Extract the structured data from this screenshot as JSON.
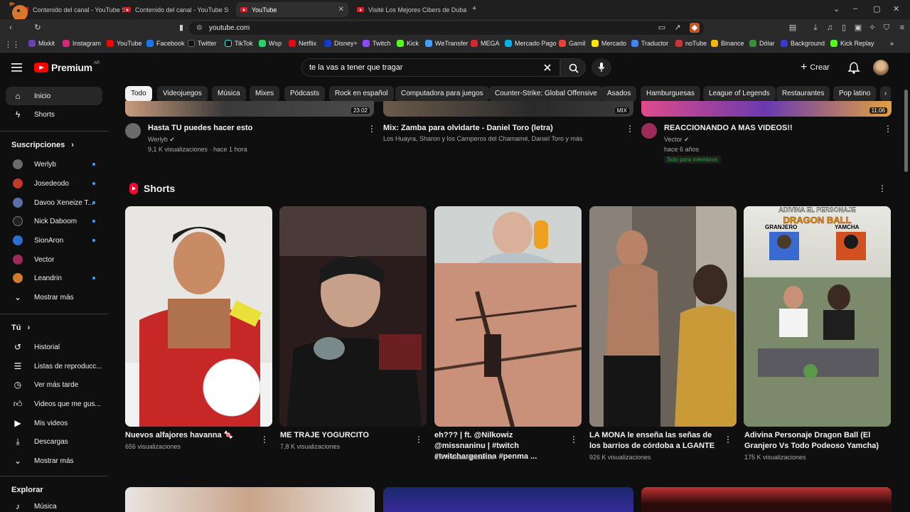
{
  "browser": {
    "tabs": [
      {
        "label": "Contenido del canal - YouTube Studi",
        "active": false
      },
      {
        "label": "Contenido del canal - YouTube Studi",
        "active": false
      },
      {
        "label": "YouTube",
        "active": true
      },
      {
        "label": "Visité Los Mejores Cibers de Dubai -",
        "active": false
      }
    ],
    "url": "youtube.com",
    "bookmarks": [
      "Mixkit",
      "Instagram",
      "YouTube",
      "Facebook",
      "Twitter",
      "TikTok",
      "Wsp",
      "Netflix",
      "Disney+",
      "Twitch",
      "Kick",
      "WeTransfer",
      "MEGA",
      "Mercado Pago",
      "Gamil",
      "Mercado",
      "Traductor",
      "noTube",
      "Binance",
      "Dólar",
      "Background",
      "Kick Replay"
    ]
  },
  "masthead": {
    "logo": "Premium",
    "region": "AR",
    "search_value": "te la vas a tener que tragar",
    "create_label": "Crear"
  },
  "chips": [
    "Todo",
    "Videojuegos",
    "Música",
    "Mixes",
    "Pódcasts",
    "Rock en español",
    "Computadora para juegos",
    "Counter-Strike: Global Offensive",
    "Asados",
    "Hamburguesas",
    "League of Legends",
    "Restaurantes",
    "Pop latino"
  ],
  "sidebar": {
    "main": [
      {
        "label": "Inicio",
        "icon": "home-icon"
      },
      {
        "label": "Shorts",
        "icon": "shorts-icon"
      }
    ],
    "subscriptions_title": "Suscripciones",
    "subscriptions": [
      {
        "label": "Werlyb",
        "color": "#6b6b6b"
      },
      {
        "label": "Josedeodo",
        "color": "#c0392b"
      },
      {
        "label": "Davoo Xeneize T...",
        "color": "#5a6fa8"
      },
      {
        "label": "Nick Daboom",
        "color": "#222222"
      },
      {
        "label": "SionAron",
        "color": "#2c6fd0"
      },
      {
        "label": "Vector",
        "color": "#9b2c5a"
      },
      {
        "label": "Leandrin",
        "color": "#d07a2c"
      }
    ],
    "show_more": "Mostrar más",
    "you_title": "Tú",
    "you": [
      {
        "label": "Historial",
        "icon": "history-icon"
      },
      {
        "label": "Listas de reproducc...",
        "icon": "playlist-icon"
      },
      {
        "label": "Ver más tarde",
        "icon": "clock-icon"
      },
      {
        "label": "Videos que me gus...",
        "icon": "like-icon"
      },
      {
        "label": "Mis videos",
        "icon": "video-icon"
      },
      {
        "label": "Descargas",
        "icon": "download-icon"
      }
    ],
    "show_more_2": "Mostrar más",
    "explore_title": "Explorar",
    "explore": [
      {
        "label": "Música",
        "icon": "music-icon"
      }
    ]
  },
  "top_videos": [
    {
      "title": "Hasta TU puedes hacer esto",
      "channel": "Werlyb",
      "meta": "9,1 K visualizaciones · hace 1 hora",
      "duration": "23:02"
    },
    {
      "title": "Mix: Zamba para olvidarte - Daniel Toro (letra)",
      "channel": "Los Huayra, Sharon y los Camperos del Chamamé, Daniel Toro y más",
      "meta": "",
      "duration": "MIX"
    },
    {
      "title": "REACCIONANDO A MAS VIDEOS!!",
      "channel": "Vector",
      "meta": "hace 6 años",
      "duration": "11:06",
      "badge": "Solo para miembros"
    }
  ],
  "shorts": {
    "title": "Shorts",
    "items": [
      {
        "title": "Nuevos alfajores havanna 🍬",
        "views": "656 visualizaciones"
      },
      {
        "title": "ME TRAJE YOGURCITO",
        "views": "7,8 K visualizaciones"
      },
      {
        "title": "eh??? | ft. @Nilkowiz @missnaninu | #twitch #twitchargentina #penma ...",
        "views": "1,4 K visualizaciones"
      },
      {
        "title": "LA MONA le enseña las señas de los barrios de córdoba a LGANTE",
        "views": "926 K visualizaciones"
      },
      {
        "title": "Adivina Personaje Dragon Ball (El Granjero Vs Todo Podeoso Yamcha)",
        "views": "175 K visualizaciones"
      }
    ],
    "overlay_texts": [
      "ADIVINA EL PERSONAJE",
      "DRAGON BALL",
      "GRANJERO",
      "YAMCHA"
    ]
  },
  "colors": {
    "brand": "#ff0000",
    "accent": "#3ea6ff",
    "members": "#2ba640"
  }
}
